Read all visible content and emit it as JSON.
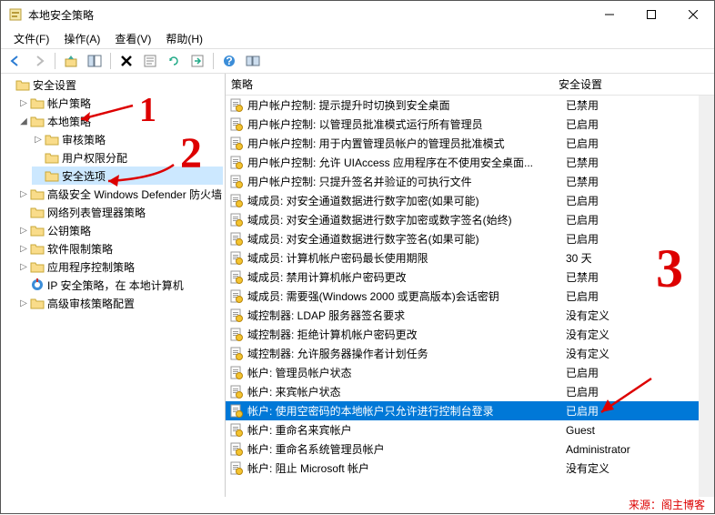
{
  "window": {
    "title": "本地安全策略"
  },
  "menu": {
    "file": "文件(F)",
    "action": "操作(A)",
    "view": "查看(V)",
    "help": "帮助(H)"
  },
  "tree": {
    "root": "安全设置",
    "items": [
      {
        "label": "帐户策略",
        "expand": "▷"
      },
      {
        "label": "本地策略",
        "expand": "◢",
        "children": [
          {
            "label": "审核策略",
            "expand": "▷"
          },
          {
            "label": "用户权限分配",
            "expand": ""
          },
          {
            "label": "安全选项",
            "expand": "",
            "selected": true
          }
        ]
      },
      {
        "label": "高级安全 Windows Defender 防火墙",
        "expand": "▷"
      },
      {
        "label": "网络列表管理器策略",
        "expand": ""
      },
      {
        "label": "公钥策略",
        "expand": "▷"
      },
      {
        "label": "软件限制策略",
        "expand": "▷"
      },
      {
        "label": "应用程序控制策略",
        "expand": "▷"
      },
      {
        "label": "IP 安全策略，在 本地计算机",
        "expand": "",
        "icon": "ip"
      },
      {
        "label": "高级审核策略配置",
        "expand": "▷"
      }
    ]
  },
  "list": {
    "headers": {
      "policy": "策略",
      "setting": "安全设置"
    },
    "rows": [
      {
        "p": "用户帐户控制: 提示提升时切换到安全桌面",
        "s": "已禁用"
      },
      {
        "p": "用户帐户控制: 以管理员批准模式运行所有管理员",
        "s": "已启用"
      },
      {
        "p": "用户帐户控制: 用于内置管理员帐户的管理员批准模式",
        "s": "已启用"
      },
      {
        "p": "用户帐户控制: 允许 UIAccess 应用程序在不使用安全桌面...",
        "s": "已禁用"
      },
      {
        "p": "用户帐户控制: 只提升签名并验证的可执行文件",
        "s": "已禁用"
      },
      {
        "p": "域成员: 对安全通道数据进行数字加密(如果可能)",
        "s": "已启用"
      },
      {
        "p": "域成员: 对安全通道数据进行数字加密或数字签名(始终)",
        "s": "已启用"
      },
      {
        "p": "域成员: 对安全通道数据进行数字签名(如果可能)",
        "s": "已启用"
      },
      {
        "p": "域成员: 计算机帐户密码最长使用期限",
        "s": "30 天"
      },
      {
        "p": "域成员: 禁用计算机帐户密码更改",
        "s": "已禁用"
      },
      {
        "p": "域成员: 需要强(Windows 2000 或更高版本)会话密钥",
        "s": "已启用"
      },
      {
        "p": "域控制器: LDAP 服务器签名要求",
        "s": "没有定义"
      },
      {
        "p": "域控制器: 拒绝计算机帐户密码更改",
        "s": "没有定义"
      },
      {
        "p": "域控制器: 允许服务器操作者计划任务",
        "s": "没有定义"
      },
      {
        "p": "帐户: 管理员帐户状态",
        "s": "已启用"
      },
      {
        "p": "帐户: 来宾帐户状态",
        "s": "已启用"
      },
      {
        "p": "帐户: 使用空密码的本地帐户只允许进行控制台登录",
        "s": "已启用",
        "selected": true
      },
      {
        "p": "帐户: 重命名来宾帐户",
        "s": "Guest"
      },
      {
        "p": "帐户: 重命名系统管理员帐户",
        "s": "Administrator"
      },
      {
        "p": "帐户: 阻止 Microsoft 帐户",
        "s": "没有定义"
      }
    ]
  },
  "annotations": {
    "n1": "1",
    "n2": "2",
    "n3": "3"
  },
  "footer": "来源：阁主博客"
}
